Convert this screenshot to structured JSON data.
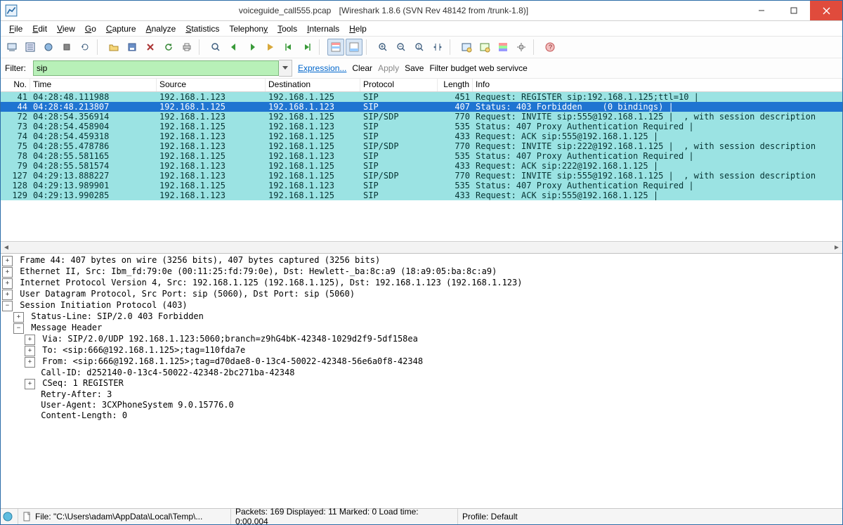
{
  "title": {
    "file": "voiceguide_call555.pcap",
    "app": "[Wireshark 1.8.6  (SVN Rev 48142 from /trunk-1.8)]"
  },
  "menus": [
    {
      "u": "F",
      "rest": "ile"
    },
    {
      "u": "E",
      "rest": "dit"
    },
    {
      "u": "V",
      "rest": "iew"
    },
    {
      "u": "G",
      "rest": "o"
    },
    {
      "u": "C",
      "rest": "apture"
    },
    {
      "u": "A",
      "rest": "nalyze"
    },
    {
      "u": "S",
      "rest": "tatistics"
    },
    {
      "u": "",
      "rest": "Telephon",
      "u2": "y"
    },
    {
      "u": "T",
      "rest": "ools"
    },
    {
      "u": "I",
      "rest": "nternals"
    },
    {
      "u": "H",
      "rest": "elp"
    }
  ],
  "filter": {
    "label": "Filter:",
    "value": "sip",
    "expression": "Expression...",
    "clear": "Clear",
    "apply": "Apply",
    "save": "Save",
    "extra": "Filter budget web servivce"
  },
  "columns": [
    "No.",
    "Time",
    "Source",
    "Destination",
    "Protocol",
    "Length",
    "Info"
  ],
  "rows": [
    {
      "no": "41",
      "time": "04:28:48.111988",
      "src": "192.168.1.123",
      "dst": "192.168.1.125",
      "proto": "SIP",
      "len": "451",
      "info": "Request: REGISTER sip:192.168.1.125;ttl=10 |",
      "sel": false
    },
    {
      "no": "44",
      "time": "04:28:48.213807",
      "src": "192.168.1.125",
      "dst": "192.168.1.123",
      "proto": "SIP",
      "len": "407",
      "info": "Status: 403 Forbidden    (0 bindings) |",
      "sel": true
    },
    {
      "no": "72",
      "time": "04:28:54.356914",
      "src": "192.168.1.123",
      "dst": "192.168.1.125",
      "proto": "SIP/SDP",
      "len": "770",
      "info": "Request: INVITE sip:555@192.168.1.125 |  , with session description",
      "sel": false
    },
    {
      "no": "73",
      "time": "04:28:54.458904",
      "src": "192.168.1.125",
      "dst": "192.168.1.123",
      "proto": "SIP",
      "len": "535",
      "info": "Status: 407 Proxy Authentication Required |",
      "sel": false
    },
    {
      "no": "74",
      "time": "04:28:54.459318",
      "src": "192.168.1.123",
      "dst": "192.168.1.125",
      "proto": "SIP",
      "len": "433",
      "info": "Request: ACK sip:555@192.168.1.125 |",
      "sel": false
    },
    {
      "no": "75",
      "time": "04:28:55.478786",
      "src": "192.168.1.123",
      "dst": "192.168.1.125",
      "proto": "SIP/SDP",
      "len": "770",
      "info": "Request: INVITE sip:222@192.168.1.125 |  , with session description",
      "sel": false
    },
    {
      "no": "78",
      "time": "04:28:55.581165",
      "src": "192.168.1.125",
      "dst": "192.168.1.123",
      "proto": "SIP",
      "len": "535",
      "info": "Status: 407 Proxy Authentication Required |",
      "sel": false
    },
    {
      "no": "79",
      "time": "04:28:55.581574",
      "src": "192.168.1.123",
      "dst": "192.168.1.125",
      "proto": "SIP",
      "len": "433",
      "info": "Request: ACK sip:222@192.168.1.125 |",
      "sel": false
    },
    {
      "no": "127",
      "time": "04:29:13.888227",
      "src": "192.168.1.123",
      "dst": "192.168.1.125",
      "proto": "SIP/SDP",
      "len": "770",
      "info": "Request: INVITE sip:555@192.168.1.125 |  , with session description",
      "sel": false
    },
    {
      "no": "128",
      "time": "04:29:13.989901",
      "src": "192.168.1.125",
      "dst": "192.168.1.123",
      "proto": "SIP",
      "len": "535",
      "info": "Status: 407 Proxy Authentication Required |",
      "sel": false
    },
    {
      "no": "129",
      "time": "04:29:13.990285",
      "src": "192.168.1.123",
      "dst": "192.168.1.125",
      "proto": "SIP",
      "len": "433",
      "info": "Request: ACK sip:555@192.168.1.125 |",
      "sel": false
    }
  ],
  "details": [
    {
      "indent": 0,
      "exp": "+",
      "text": "Frame 44: 407 bytes on wire (3256 bits), 407 bytes captured (3256 bits)"
    },
    {
      "indent": 0,
      "exp": "+",
      "text": "Ethernet II, Src: Ibm_fd:79:0e (00:11:25:fd:79:0e), Dst: Hewlett-_ba:8c:a9 (18:a9:05:ba:8c:a9)"
    },
    {
      "indent": 0,
      "exp": "+",
      "text": "Internet Protocol Version 4, Src: 192.168.1.125 (192.168.1.125), Dst: 192.168.1.123 (192.168.1.123)"
    },
    {
      "indent": 0,
      "exp": "+",
      "text": "User Datagram Protocol, Src Port: sip (5060), Dst Port: sip (5060)"
    },
    {
      "indent": 0,
      "exp": "-",
      "text": "Session Initiation Protocol (403)"
    },
    {
      "indent": 1,
      "exp": "+",
      "text": "Status-Line: SIP/2.0 403 Forbidden"
    },
    {
      "indent": 1,
      "exp": "-",
      "text": "Message Header"
    },
    {
      "indent": 2,
      "exp": "+",
      "text": "Via: SIP/2.0/UDP 192.168.1.123:5060;branch=z9hG4bK-42348-1029d2f9-5df158ea"
    },
    {
      "indent": 2,
      "exp": "+",
      "text": "To: <sip:666@192.168.1.125>;tag=110fda7e"
    },
    {
      "indent": 2,
      "exp": "+",
      "text": "From: <sip:666@192.168.1.125>;tag=d70dae8-0-13c4-50022-42348-56e6a0f8-42348"
    },
    {
      "indent": 2,
      "exp": "",
      "text": "Call-ID: d252140-0-13c4-50022-42348-2bc271ba-42348"
    },
    {
      "indent": 2,
      "exp": "+",
      "text": "CSeq: 1 REGISTER"
    },
    {
      "indent": 2,
      "exp": "",
      "text": "Retry-After: 3"
    },
    {
      "indent": 2,
      "exp": "",
      "text": "User-Agent: 3CXPhoneSystem 9.0.15776.0"
    },
    {
      "indent": 2,
      "exp": "",
      "text": "Content-Length: 0"
    }
  ],
  "status": {
    "file": "File: \"C:\\Users\\adam\\AppData\\Local\\Temp\\...",
    "packets": "Packets: 169 Displayed: 11 Marked: 0 Load time: 0:00.004",
    "profile": "Profile: Default"
  },
  "toolbar_icons": [
    "interfaces-icon",
    "options-icon",
    "start-capture-icon",
    "stop-capture-icon",
    "restart-capture-icon",
    "sep",
    "open-icon",
    "save-icon",
    "close-icon",
    "reload-icon",
    "print-icon",
    "sep",
    "find-icon",
    "back-icon",
    "forward-icon",
    "goto-icon",
    "go-first-icon",
    "go-last-icon",
    "sep",
    "colorize-icon",
    "auto-scroll-icon",
    "sep",
    "zoom-in-icon",
    "zoom-out-icon",
    "zoom-reset-icon",
    "resize-cols-icon",
    "sep",
    "capture-filters-icon",
    "display-filters-icon",
    "coloring-rules-icon",
    "prefs-icon",
    "sep",
    "help-icon"
  ]
}
